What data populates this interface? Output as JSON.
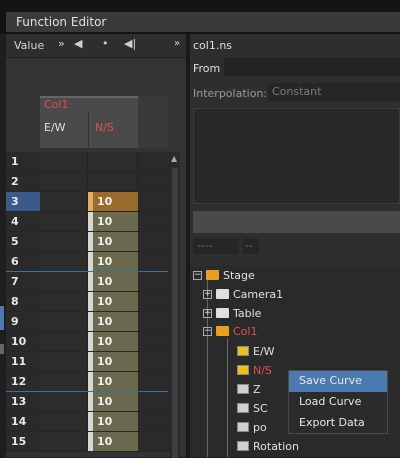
{
  "window": {
    "title": "Function Editor"
  },
  "left_toolbar": {
    "value_label": "Value",
    "icons": [
      "double-chevron-icon",
      "prev-key-icon",
      "next-key-icon",
      "first-frame-icon"
    ]
  },
  "column_header": {
    "group": "Col1",
    "col_ew": "E/W",
    "col_ns": "N/S"
  },
  "grid": {
    "current_row": 3,
    "rows": [
      {
        "num": "1",
        "ns": ""
      },
      {
        "num": "2",
        "ns": ""
      },
      {
        "num": "3",
        "ns": "10"
      },
      {
        "num": "4",
        "ns": "10"
      },
      {
        "num": "5",
        "ns": "10"
      },
      {
        "num": "6",
        "ns": "10"
      },
      {
        "num": "7",
        "ns": "10"
      },
      {
        "num": "8",
        "ns": "10"
      },
      {
        "num": "9",
        "ns": "10"
      },
      {
        "num": "10",
        "ns": "10"
      },
      {
        "num": "11",
        "ns": "10"
      },
      {
        "num": "12",
        "ns": "10"
      },
      {
        "num": "13",
        "ns": "10"
      },
      {
        "num": "14",
        "ns": "10"
      },
      {
        "num": "15",
        "ns": "10"
      }
    ]
  },
  "right_panel": {
    "curve_name": "col1.ns",
    "from_label": "From",
    "from_value": "",
    "interpolation_label": "Interpolation:",
    "interpolation_value": "Constant",
    "small_field_1": "----",
    "small_field_2": "--"
  },
  "tree": {
    "items": [
      {
        "label": "Stage"
      },
      {
        "label": "Camera1"
      },
      {
        "label": "Table"
      },
      {
        "label": "Col1"
      },
      {
        "label": "E/W"
      },
      {
        "label": "N/S"
      },
      {
        "label": "Z"
      },
      {
        "label": "SC"
      },
      {
        "label": "po"
      },
      {
        "label": "Rotation"
      }
    ]
  },
  "context_menu": {
    "items": [
      {
        "label": "Save Curve",
        "active": true
      },
      {
        "label": "Load Curve",
        "active": false
      },
      {
        "label": "Export Data",
        "active": false
      }
    ]
  },
  "colors": {
    "accent": "#4a7ab0",
    "curve_highlight": "#e05050",
    "folder_open": "#e8a020"
  }
}
